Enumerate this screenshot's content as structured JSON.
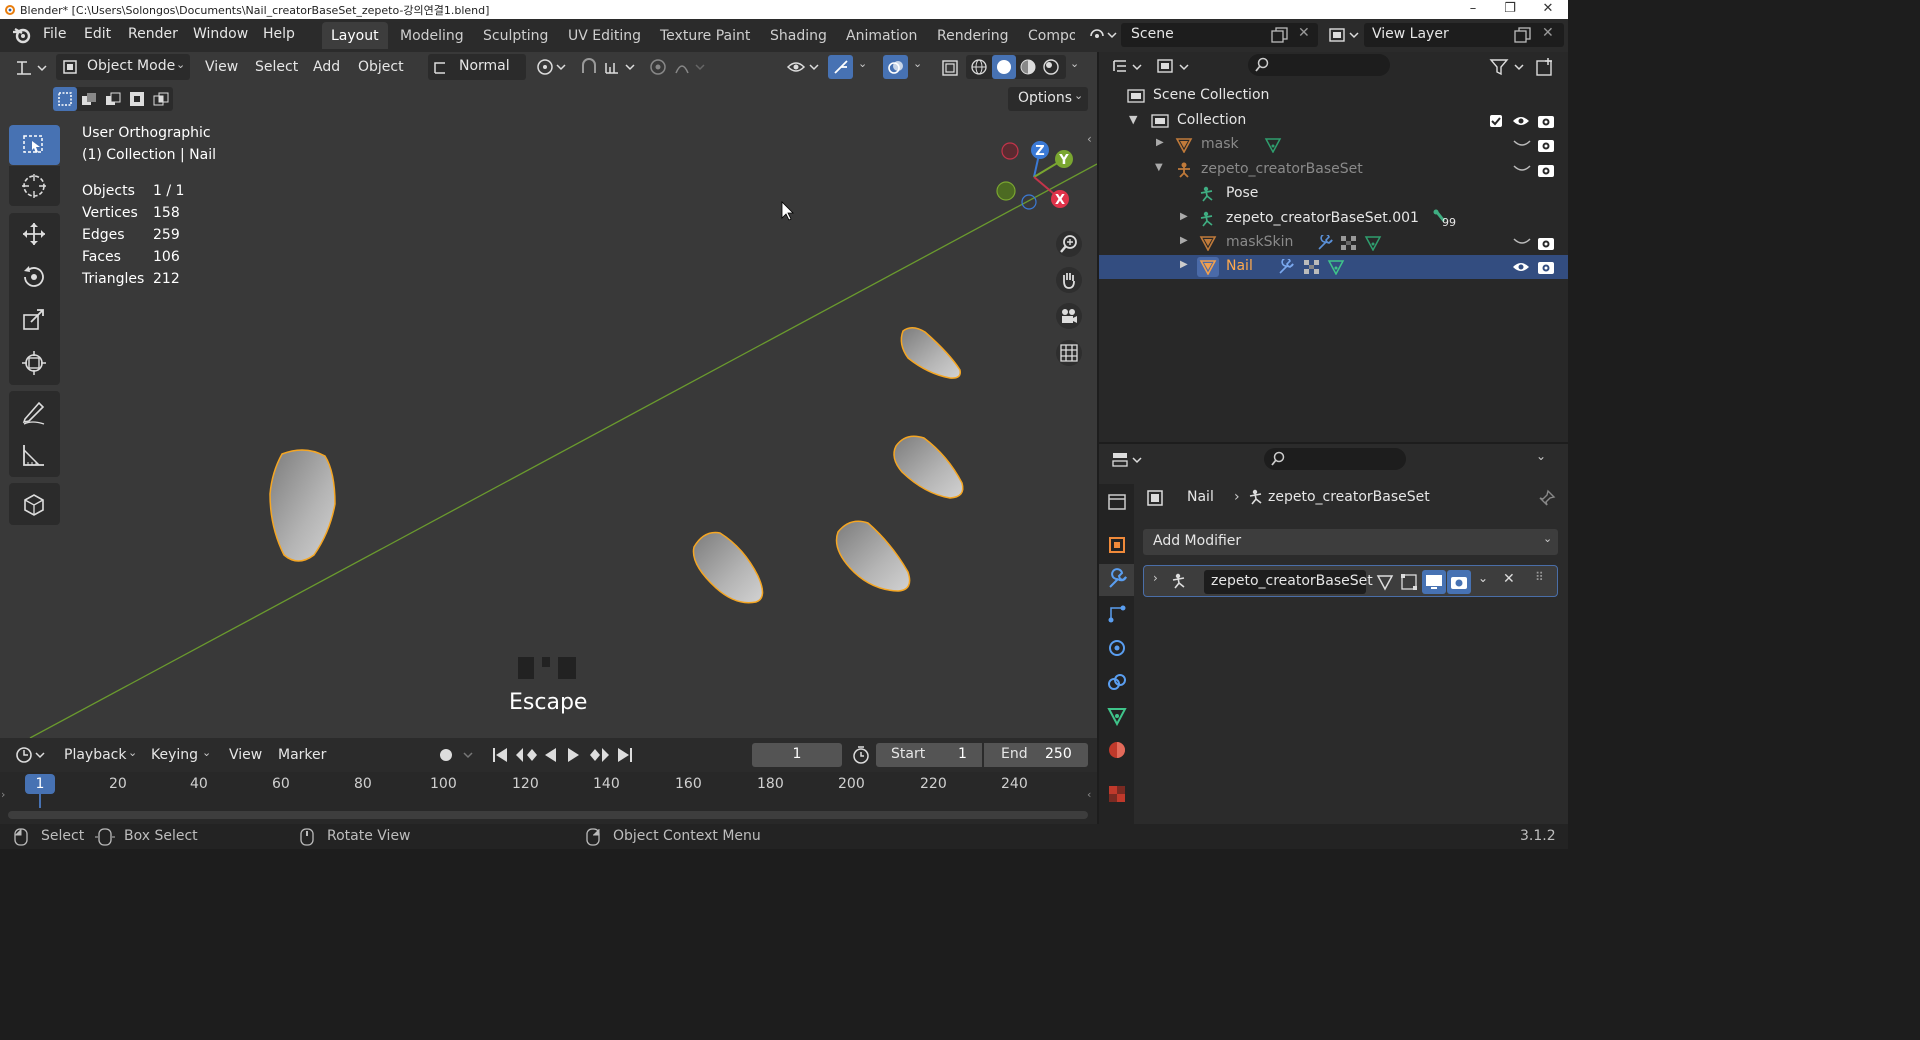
{
  "window": {
    "title": "Blender* [C:\\Users\\Solongos\\Documents\\Nail_creatorBaseSet_zepeto-강의연결1.blend]",
    "minimize": "–",
    "maximize": "❐",
    "close": "✕"
  },
  "menubar": {
    "items": [
      "File",
      "Edit",
      "Render",
      "Window",
      "Help"
    ],
    "workspaces": [
      "Layout",
      "Modeling",
      "Sculpting",
      "UV Editing",
      "Texture Paint",
      "Shading",
      "Animation",
      "Rendering",
      "Compo"
    ],
    "active_workspace": "Layout",
    "scene": "Scene",
    "view_layer": "View Layer"
  },
  "viewport": {
    "mode": "Object Mode",
    "menus": [
      "View",
      "Select",
      "Add",
      "Object"
    ],
    "orientation": "Normal",
    "options_label": "Options",
    "view_name": "User Orthographic",
    "collection_path": "(1) Collection | Nail",
    "stats": [
      {
        "label": "Objects",
        "value": "1 / 1"
      },
      {
        "label": "Vertices",
        "value": "158"
      },
      {
        "label": "Edges",
        "value": "259"
      },
      {
        "label": "Faces",
        "value": "106"
      },
      {
        "label": "Triangles",
        "value": "212"
      }
    ],
    "key_overlay": "Escape",
    "gizmo_axes": {
      "x": "X",
      "y": "Y",
      "z": "Z"
    },
    "colors": {
      "background": "#393939",
      "selection_outline": "#f5a623",
      "axis_line": "#6a9a2e"
    }
  },
  "timeline": {
    "menus": [
      "Playback",
      "Keying",
      "View",
      "Marker"
    ],
    "current_frame": "1",
    "start_label": "Start",
    "start_value": "1",
    "end_label": "End",
    "end_value": "250",
    "frame_marker": "1",
    "ticks": [
      "20",
      "40",
      "60",
      "80",
      "100",
      "120",
      "140",
      "160",
      "180",
      "200",
      "220",
      "240"
    ]
  },
  "status_bar": {
    "select": "Select",
    "box_select": "Box Select",
    "rotate_view": "Rotate View",
    "context_menu": "Object Context Menu",
    "version": "3.1.2"
  },
  "outliner": {
    "scene_collection": "Scene Collection",
    "collection": "Collection",
    "items": [
      {
        "name": "mask",
        "dim": true
      },
      {
        "name": "zepeto_creatorBaseSet",
        "dim": true
      },
      {
        "name": "Pose",
        "dim": false
      },
      {
        "name": "zepeto_creatorBaseSet.001",
        "dim": false,
        "badge": "99"
      },
      {
        "name": "maskSkin",
        "dim": true
      },
      {
        "name": "Nail",
        "dim": false,
        "selected": true
      }
    ]
  },
  "properties": {
    "breadcrumb_object": "Nail",
    "breadcrumb_armature": "zepeto_creatorBaseSet",
    "add_modifier": "Add Modifier",
    "modifier_name": "zepeto_creatorBaseSet"
  }
}
